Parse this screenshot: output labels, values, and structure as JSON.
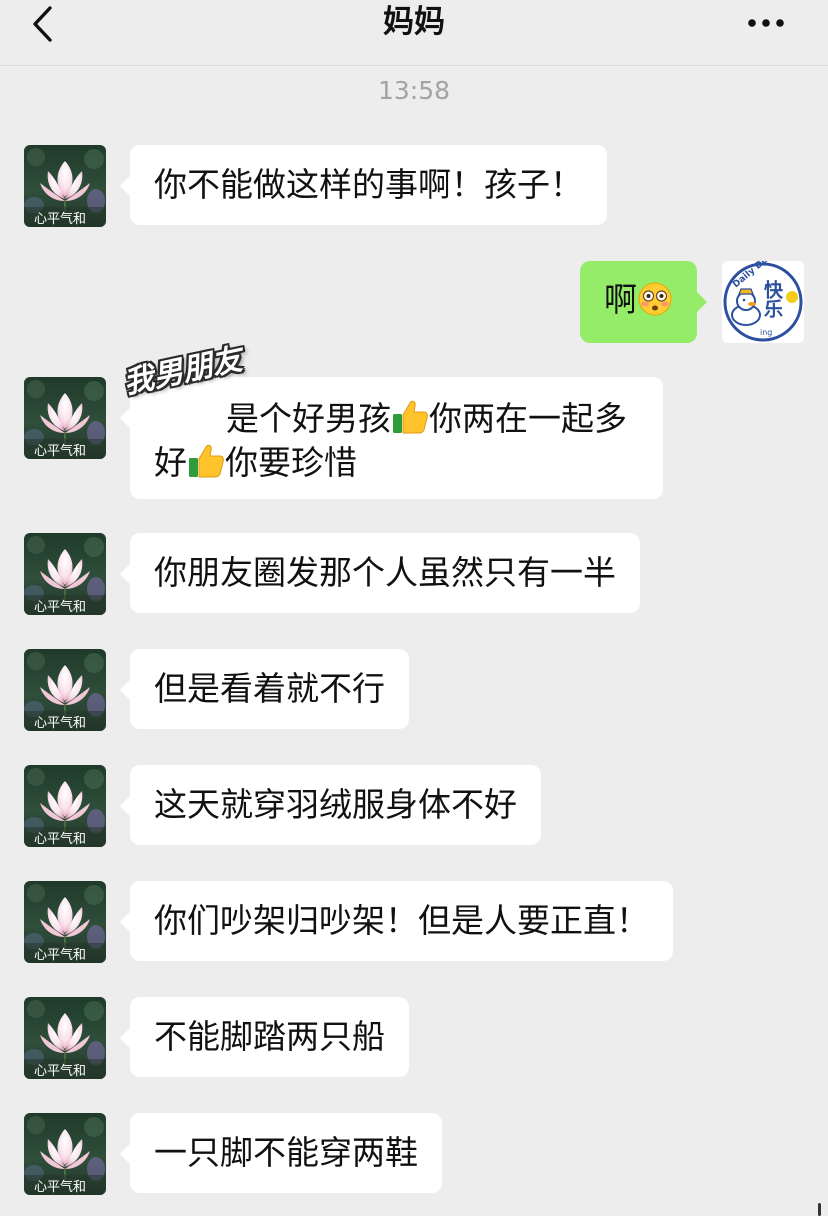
{
  "header": {
    "title": "妈妈",
    "back_icon": "chevron-left-icon",
    "more_icon": "ellipsis-icon"
  },
  "timestamp": "13:58",
  "contact": {
    "avatar_caption": "心平气和"
  },
  "me": {
    "avatar_text_main": "快乐",
    "avatar_text_side": "Daily Duck",
    "avatar_text_ing": "ing"
  },
  "sticker_label": "我男朋友",
  "messages": [
    {
      "from": "contact",
      "text": "你不能做这样的事啊！孩子！"
    },
    {
      "from": "me",
      "text": "啊",
      "emoji": "flushed-face-icon"
    },
    {
      "from": "contact",
      "line1_a": "是个好男孩",
      "line1_b": "你两在一起多",
      "line2_a": "好",
      "line2_b": "你要珍惜",
      "emoji": "thumbs-up-icon"
    },
    {
      "from": "contact",
      "text": "你朋友圈发那个人虽然只有一半"
    },
    {
      "from": "contact",
      "text": "但是看着就不行"
    },
    {
      "from": "contact",
      "text": "这天就穿羽绒服身体不好"
    },
    {
      "from": "contact",
      "text": "你们吵架归吵架！但是人要正直！"
    },
    {
      "from": "contact",
      "text": "不能脚踏两只船"
    },
    {
      "from": "contact",
      "text": "一只脚不能穿两鞋"
    }
  ],
  "colors": {
    "background": "#ededed",
    "bubble_contact": "#ffffff",
    "bubble_me": "#95ec69",
    "timestamp": "#a3a3a3"
  }
}
